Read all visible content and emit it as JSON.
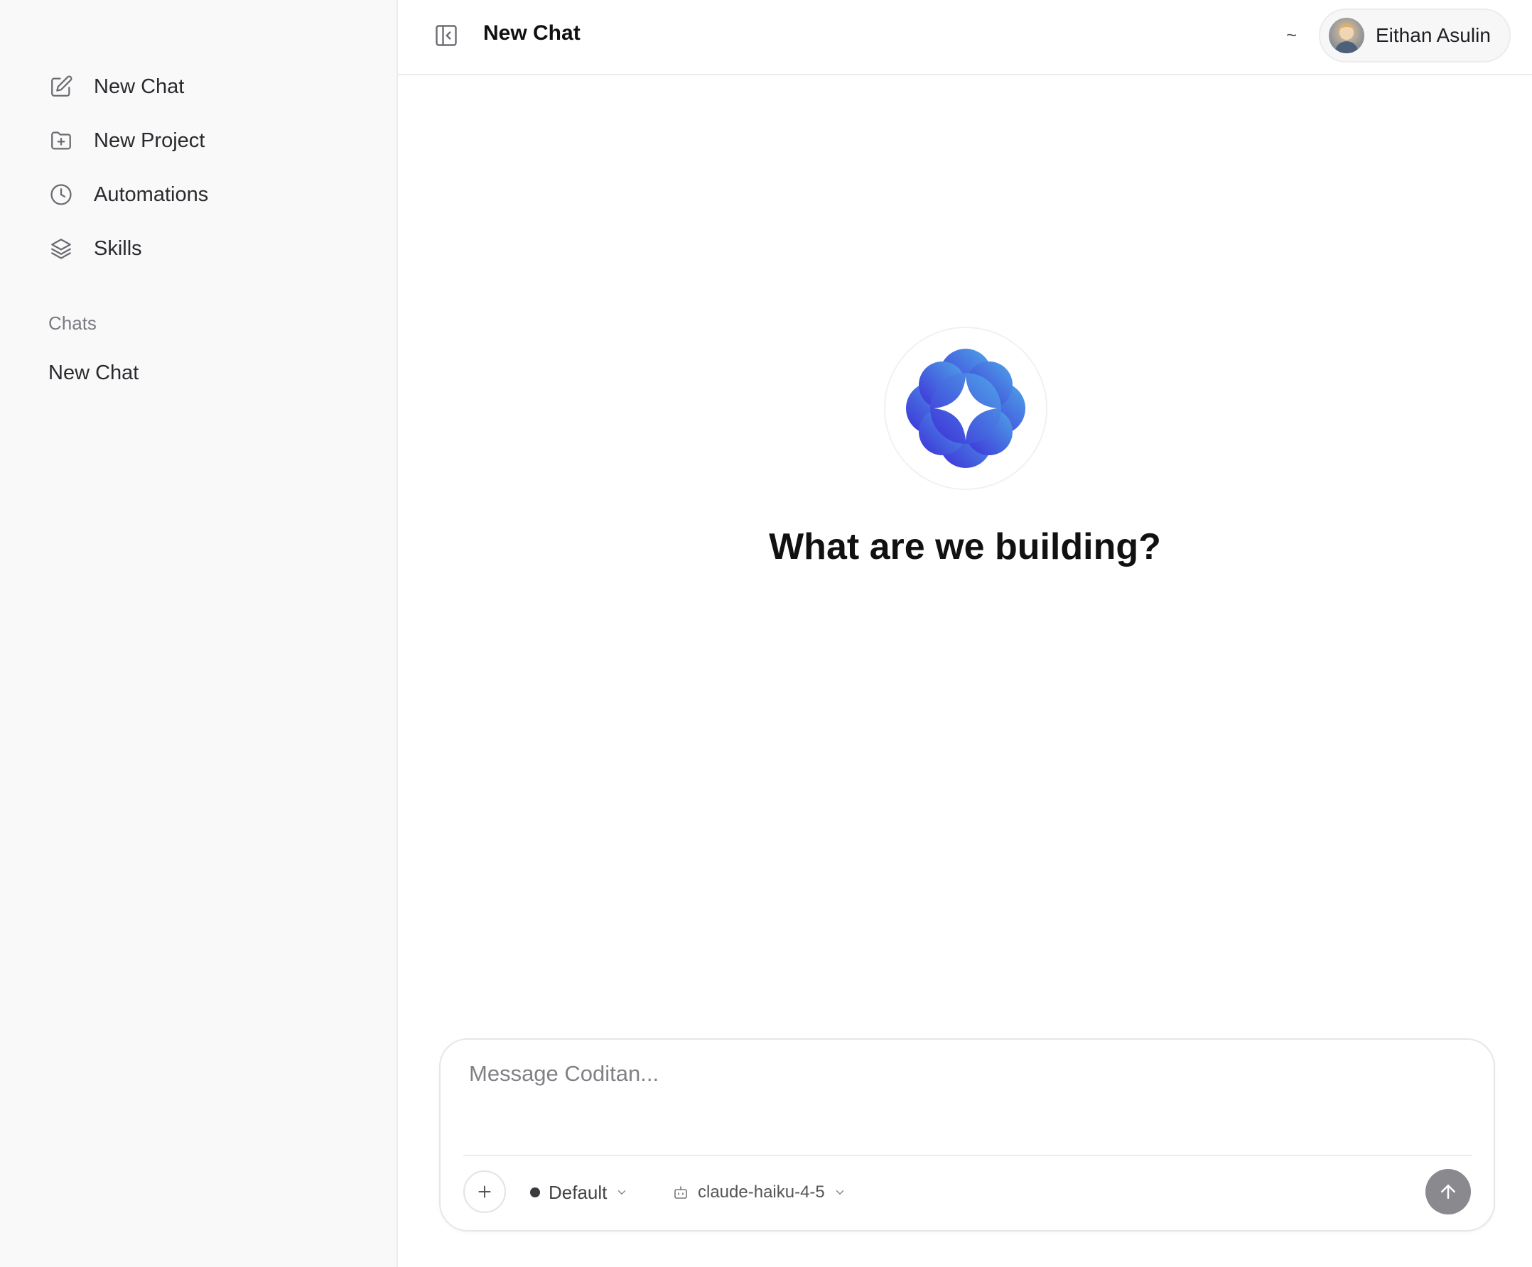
{
  "sidebar": {
    "items": [
      {
        "label": "New Chat",
        "icon": "edit-icon"
      },
      {
        "label": "New Project",
        "icon": "folder-plus-icon"
      },
      {
        "label": "Automations",
        "icon": "clock-icon"
      },
      {
        "label": "Skills",
        "icon": "layers-icon"
      }
    ],
    "section_title": "Chats",
    "chats": [
      "New Chat"
    ]
  },
  "header": {
    "title": "New Chat",
    "tilde": "~",
    "user_name": "Eithan Asulin"
  },
  "main": {
    "hero_title": "What are we building?"
  },
  "composer": {
    "placeholder": "Message Coditan...",
    "mode_label": "Default",
    "model_label": "claude-haiku-4-5"
  },
  "colors": {
    "logo_gradient_start": "#3d2fd8",
    "logo_gradient_end": "#4fa6e8",
    "send_button": "#8a8a8e",
    "sidebar_bg": "#f9f9fa"
  }
}
